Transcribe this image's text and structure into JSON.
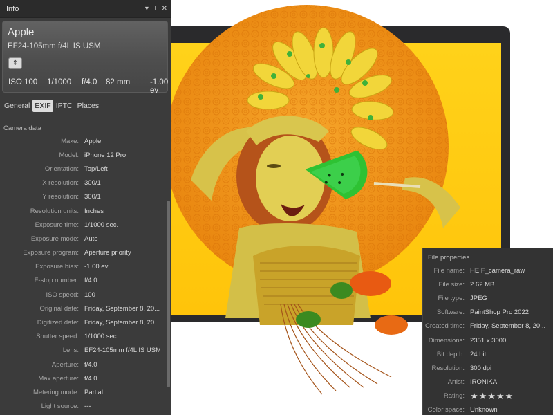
{
  "info_panel": {
    "title": "Info",
    "title_icons": {
      "dropdown": "▾",
      "pin": "⊥",
      "close": "✕"
    },
    "camera": {
      "make": "Apple",
      "lens": "EF24-105mm f/4L IS USM",
      "toggle_icon": "⇕",
      "stats": [
        "ISO 100",
        "1/1000",
        "f/4.0",
        "82 mm",
        "-1.00 ev"
      ]
    },
    "tabs": [
      "General",
      "EXIF",
      "IPTC",
      "Places"
    ],
    "active_tab": "EXIF",
    "section_title": "Camera data",
    "rows": [
      {
        "label": "Make:",
        "value": "Apple"
      },
      {
        "label": "Model:",
        "value": "iPhone 12 Pro"
      },
      {
        "label": "Orientation:",
        "value": "Top/Left"
      },
      {
        "label": "X resolution:",
        "value": "300/1"
      },
      {
        "label": "Y resolution:",
        "value": "300/1"
      },
      {
        "label": "Resolution units:",
        "value": "Inches"
      },
      {
        "label": "Exposure time:",
        "value": "1/1000 sec."
      },
      {
        "label": "Exposure mode:",
        "value": "Auto"
      },
      {
        "label": "Exposure program:",
        "value": "Aperture priority"
      },
      {
        "label": "Exposure bias:",
        "value": "-1.00 ev"
      },
      {
        "label": "F-stop number:",
        "value": "f/4.0"
      },
      {
        "label": "ISO speed:",
        "value": "100"
      },
      {
        "label": "Original date:",
        "value": "Friday, September 8, 20..."
      },
      {
        "label": "Digitized date:",
        "value": "Friday, September 8, 20..."
      },
      {
        "label": "Shutter speed:",
        "value": "1/1000 sec."
      },
      {
        "label": "Lens:",
        "value": "EF24-105mm f/4L IS USM"
      },
      {
        "label": "Aperture:",
        "value": "f/4.0"
      },
      {
        "label": "Max aperture:",
        "value": "f/4.0"
      },
      {
        "label": "Metering mode:",
        "value": "Partial"
      },
      {
        "label": "Light source:",
        "value": "---"
      }
    ]
  },
  "file_properties": {
    "title": "File properties",
    "rows": [
      {
        "label": "File name:",
        "value": "HEIF_camera_raw"
      },
      {
        "label": "File size:",
        "value": "2.62 MB"
      },
      {
        "label": "File type:",
        "value": "JPEG"
      },
      {
        "label": "Software:",
        "value": "PaintShop Pro 2022"
      },
      {
        "label": "Created time:",
        "value": "Friday, September 8, 20..."
      },
      {
        "label": "Dimensions:",
        "value": "2351 x 3000"
      },
      {
        "label": "Bit depth:",
        "value": "24 bit"
      },
      {
        "label": "Resolution:",
        "value": "300 dpi"
      },
      {
        "label": "Artist:",
        "value": "IRONIKA"
      },
      {
        "label": "Rating:",
        "value": "★★★★★"
      },
      {
        "label": "Color space:",
        "value": "Unknown"
      }
    ]
  },
  "colors": {
    "panel_bg": "#3b3b3b",
    "accent_orange": "#f39a1c",
    "screen_yellow": "#ffc40a",
    "star_gold": "#f5c518"
  }
}
